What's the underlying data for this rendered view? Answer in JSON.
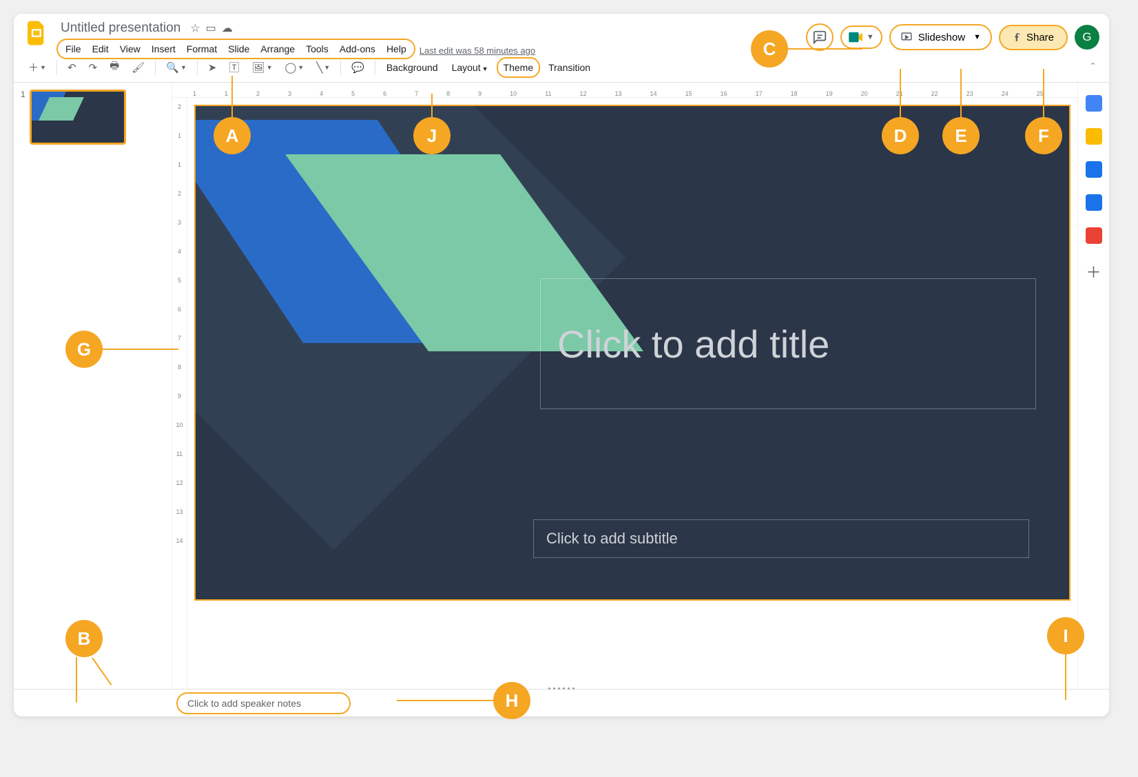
{
  "document": {
    "title": "Untitled presentation",
    "edit_status": "Last edit was 58 minutes ago"
  },
  "menus": [
    "File",
    "Edit",
    "View",
    "Insert",
    "Format",
    "Slide",
    "Arrange",
    "Tools",
    "Add-ons",
    "Help"
  ],
  "header_buttons": {
    "slideshow": "Slideshow",
    "share": "Share"
  },
  "avatar_initial": "G",
  "toolbar_text": {
    "background": "Background",
    "layout": "Layout",
    "theme": "Theme",
    "transition": "Transition"
  },
  "ruler_h": [
    "1",
    "1",
    "2",
    "3",
    "4",
    "5",
    "6",
    "7",
    "8",
    "9",
    "10",
    "11",
    "12",
    "13",
    "14",
    "15",
    "16",
    "17",
    "18",
    "19",
    "20",
    "21",
    "22",
    "23",
    "24",
    "25"
  ],
  "ruler_v": [
    "2",
    "1",
    "1",
    "2",
    "3",
    "4",
    "5",
    "6",
    "7",
    "8",
    "9",
    "10",
    "11",
    "12",
    "13",
    "14"
  ],
  "thumbnails": [
    {
      "index": "1"
    }
  ],
  "slide": {
    "title_placeholder": "Click to add title",
    "subtitle_placeholder": "Click to add subtitle"
  },
  "speaker_notes_placeholder": "Click to add speaker notes",
  "sidepanel_icons": [
    {
      "name": "calendar",
      "color": "#4285f4"
    },
    {
      "name": "keep",
      "color": "#fbbc04"
    },
    {
      "name": "tasks",
      "color": "#1a73e8"
    },
    {
      "name": "contacts",
      "color": "#1a73e8"
    },
    {
      "name": "maps",
      "color": "#ea4335"
    },
    {
      "name": "add",
      "color": "#5f6368"
    }
  ],
  "callouts": {
    "A": "A",
    "B": "B",
    "C": "C",
    "D": "D",
    "E": "E",
    "F": "F",
    "G": "G",
    "H": "H",
    "I": "I",
    "J": "J"
  }
}
